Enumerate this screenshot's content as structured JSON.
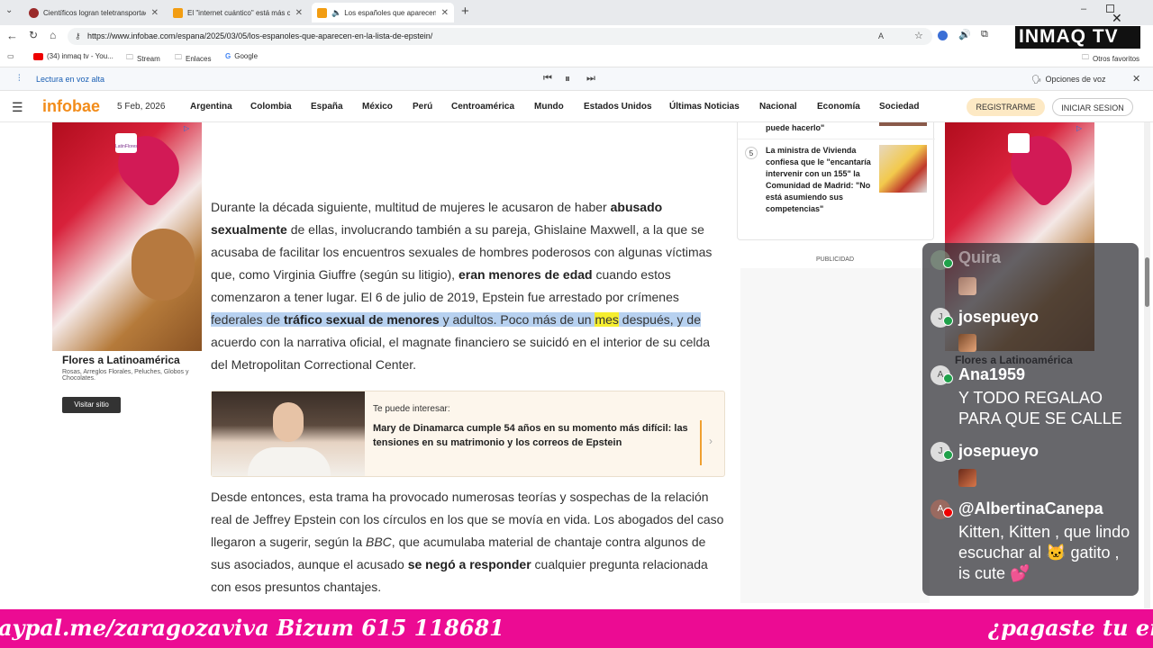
{
  "browser": {
    "tabs": [
      {
        "title": "Científicos logran teletransportació",
        "color": "#9a2a2a"
      },
      {
        "title": "El \"internet cuántico\" está más cer",
        "color": "#f29d12"
      },
      {
        "title": "Los españoles que aparecen e",
        "color": "#f29d12"
      }
    ],
    "url": "https://www.infobae.com/espana/2025/03/05/los-espanoles-que-aparecen-en-la-lista-de-epstein/",
    "bookmarks": [
      "(34) inmaq tv - You...",
      "Stream",
      "Enlaces",
      "Google"
    ],
    "other_bookmarks": "Otros favoritos",
    "read_aloud": "Lectura en voz alta",
    "voice_options": "Opciones de voz"
  },
  "site": {
    "logo": "infobae",
    "date": "5 Feb, 2026",
    "nav": [
      "Argentina",
      "Colombia",
      "España",
      "México",
      "Perú",
      "Centroamérica",
      "Mundo",
      "Estados Unidos",
      "Últimas Noticias",
      "Nacional",
      "Economía",
      "Sociedad"
    ],
    "register": "REGISTRARME",
    "login": "INICIAR SESION"
  },
  "article": {
    "p1": {
      "t1": "Durante la década siguiente, multitud de mujeres le acusaron de haber ",
      "b1": "abusado sexualmente",
      "t2": " de ellas, involucrando también a su pareja, Ghislaine Maxwell, a la que se acusaba de facilitar los encuentros sexuales de hombres poderosos con algunas víctimas que, como Virginia Giuffre (según su litigio), ",
      "b2": "eran menores de edad",
      "t3": " cuando estos comenzaron a tener lugar. El 6 de julio de 2019, Epstein fue arrestado por crímenes ",
      "h1": "federales de ",
      "hb": "tráfico sexual de menores",
      "h2": " y adultos. Poco más de un ",
      "hy": "mes",
      "h3": " después, y de",
      "t4": " acuerdo con la narrativa oficial, el magnate financiero se suicidó en el interior de su celda del Metropolitan Correctional Center."
    },
    "related": {
      "label": "Te puede interesar:",
      "title": "Mary de Dinamarca cumple 54 años en su momento más difícil: las tensiones en su matrimonio y los correos de Epstein"
    },
    "p2": {
      "t1": "Desde entonces, esta trama ha provocado numerosas teorías y sospechas de la relación real de Jeffrey Epstein con los círculos en los que se movía en vida. Los abogados del caso llegaron a sugerir, según la ",
      "i1": "BBC",
      "t2": ", que acumulaba material de chantaje contra algunos de sus asociados, aunque el acusado ",
      "b1": "se negó a responder",
      "t3": " cualquier pregunta relacionada con esos presuntos chantajes."
    }
  },
  "sidebar": {
    "prev_tail": "puede hacerlo\"",
    "item5": {
      "num": "5",
      "title": "La ministra de Vivienda confiesa que le \"encantaría intervenir con un 155\" la Comunidad de Madrid: \"No está asumiendo sus competencias\""
    },
    "publicidad": "PUBLICIDAD"
  },
  "ad": {
    "brand": "LatinFlores",
    "title": "Flores a Latinoamérica",
    "desc": "Rosas, Arreglos Florales, Peluches, Globos y Chocolates.",
    "cta": "Visitar sitio"
  },
  "chat": {
    "faded_user": "Quira",
    "messages": [
      {
        "user": "josepueyo",
        "avatar": "J",
        "text": ""
      },
      {
        "user": "Ana1959",
        "avatar": "A",
        "text": "Y TODO REGALAO PARA QUE SE CALLE"
      },
      {
        "user": "josepueyo",
        "avatar": "J",
        "text": ""
      },
      {
        "user": "@AlbertinaCanepa",
        "avatar": "A",
        "text": "Kitten, Kitten , que lindo escuchar al 🐱 gatito , is cute 💕"
      }
    ]
  },
  "overlay": {
    "logo": "INMAQ TV",
    "ticker_left": "aypal.me/zaragozaviva Bizum 615 118681",
    "ticker_right": "¿pagaste tu entr"
  }
}
